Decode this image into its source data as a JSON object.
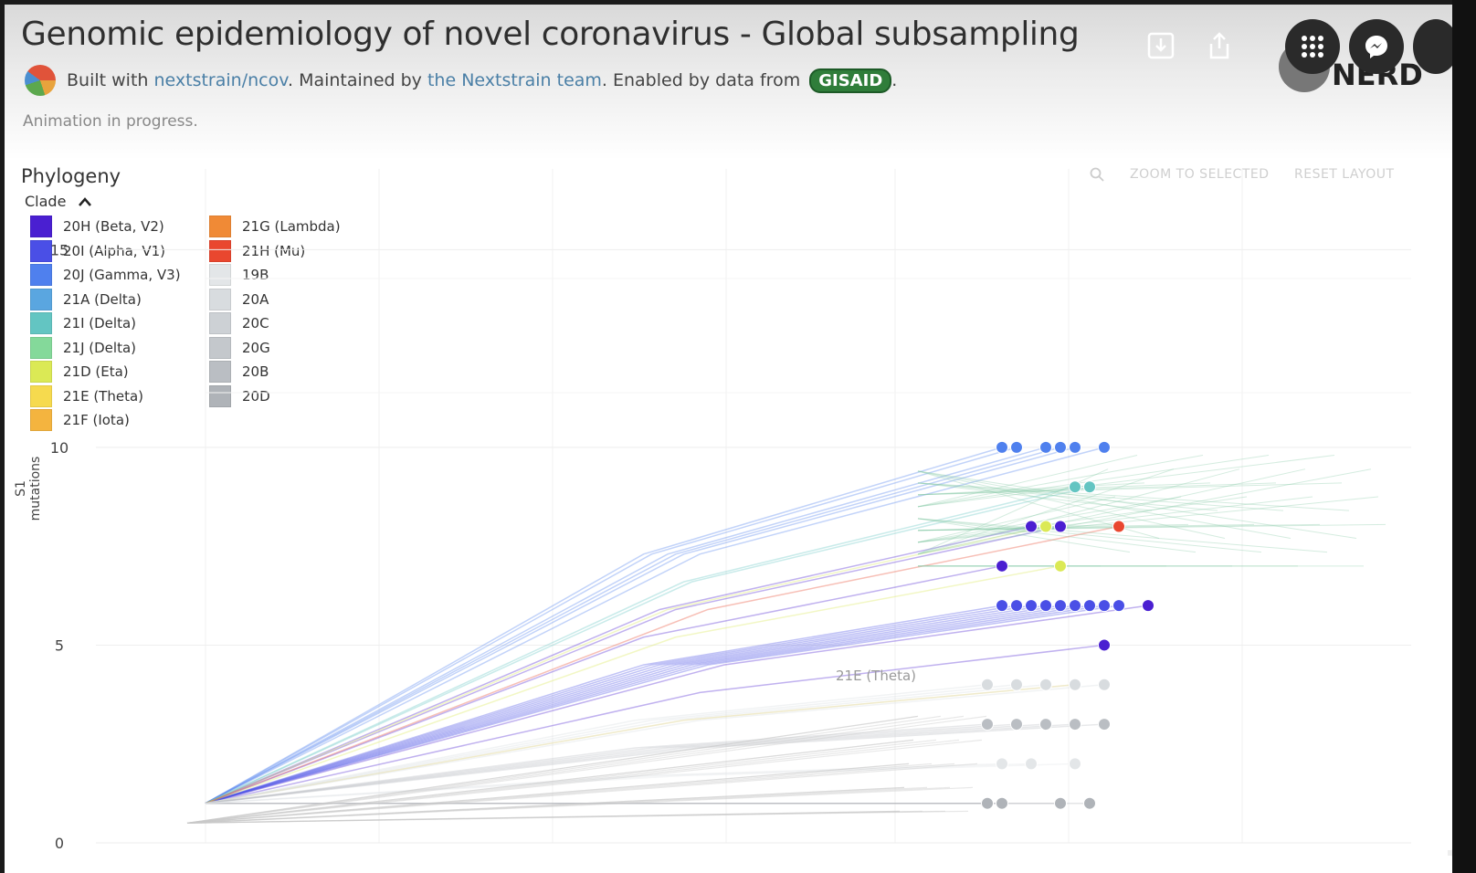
{
  "header": {
    "title": "Genomic epidemiology of novel coronavirus - Global subsampling",
    "built_prefix": "Built with ",
    "built_link": "nextstrain/ncov",
    "maintained_prefix": ". Maintained by ",
    "maintained_link": "the Nextstrain team",
    "enabled_prefix": ". Enabled by data from ",
    "gisaid": "GISAID",
    "enabled_suffix": ".",
    "status": "Animation in progress."
  },
  "icons": {
    "save": "save-icon",
    "share": "share-icon",
    "apps": "apps-grid-icon",
    "messenger": "messenger-icon",
    "mute": "mute-icon"
  },
  "brand": {
    "text": "NERD"
  },
  "panel": {
    "title": "Phylogeny",
    "legend_title": "Clade",
    "zoom_to_selected": "ZOOM TO SELECTED",
    "reset_layout": "RESET LAYOUT"
  },
  "legend": {
    "col1": [
      {
        "label": "20H (Beta, V2)",
        "color": "#4a1fd1"
      },
      {
        "label": "20I (Alpha, V1)",
        "color": "#4a4fe6"
      },
      {
        "label": "20J (Gamma, V3)",
        "color": "#4f80ee"
      },
      {
        "label": "21A (Delta)",
        "color": "#5aa6e0"
      },
      {
        "label": "21I (Delta)",
        "color": "#63c5c2"
      },
      {
        "label": "21J (Delta)",
        "color": "#84d99a"
      },
      {
        "label": "21D (Eta)",
        "color": "#dbe955"
      },
      {
        "label": "21E (Theta)",
        "color": "#f6da4e"
      },
      {
        "label": "21F (Iota)",
        "color": "#f4b43f"
      }
    ],
    "col2": [
      {
        "label": "21G (Lambda)",
        "color": "#f08a36"
      },
      {
        "label": "21H (Mu)",
        "color": "#e9472f"
      },
      {
        "label": "19B",
        "color": "#e3e6e8"
      },
      {
        "label": "20A",
        "color": "#d8dcdf"
      },
      {
        "label": "20C",
        "color": "#cdd1d5"
      },
      {
        "label": "20G",
        "color": "#c4c8cc"
      },
      {
        "label": "20B",
        "color": "#babec3"
      },
      {
        "label": "20D",
        "color": "#afb3b8"
      }
    ]
  },
  "chart_data": {
    "type": "scatter",
    "title": "Phylogeny",
    "xlabel": "",
    "ylabel": "S1 mutations",
    "ylim": [
      0,
      16
    ],
    "yticks": [
      0,
      5,
      10,
      15
    ],
    "grid": true,
    "annotation": "21E (Theta)",
    "series": [
      {
        "name": "20H (Beta, V2)",
        "x": [
          0.62,
          0.64,
          0.66,
          0.69,
          0.72
        ],
        "y": [
          7,
          8,
          8,
          5,
          6
        ]
      },
      {
        "name": "20I (Alpha, V1)",
        "x": [
          0.62,
          0.63,
          0.64,
          0.65,
          0.66,
          0.67,
          0.68,
          0.69,
          0.7
        ],
        "y": [
          6,
          6,
          6,
          6,
          6,
          6,
          6,
          6,
          6
        ]
      },
      {
        "name": "20J (Gamma, V3)",
        "x": [
          0.62,
          0.63,
          0.65,
          0.66,
          0.67,
          0.69
        ],
        "y": [
          10,
          10,
          10,
          10,
          10,
          10
        ]
      },
      {
        "name": "21I (Delta)",
        "x": [
          0.67,
          0.68
        ],
        "y": [
          9,
          9
        ]
      },
      {
        "name": "21D (Eta)",
        "x": [
          0.65,
          0.66
        ],
        "y": [
          8,
          7
        ]
      },
      {
        "name": "21E (Theta)",
        "x": [
          0.67
        ],
        "y": [
          4
        ]
      },
      {
        "name": "21H (Mu)",
        "x": [
          0.7
        ],
        "y": [
          8
        ]
      },
      {
        "name": "20A",
        "x": [
          0.61,
          0.63,
          0.65,
          0.67,
          0.69
        ],
        "y": [
          4,
          4,
          4,
          4,
          4
        ]
      },
      {
        "name": "20B",
        "x": [
          0.61,
          0.63,
          0.65,
          0.67,
          0.69
        ],
        "y": [
          3,
          3,
          3,
          3,
          3
        ]
      },
      {
        "name": "20D",
        "x": [
          0.61,
          0.62,
          0.66,
          0.68
        ],
        "y": [
          1,
          1,
          1,
          1
        ]
      },
      {
        "name": "19B",
        "x": [
          0.62,
          0.64,
          0.67
        ],
        "y": [
          2,
          2,
          2
        ]
      }
    ]
  }
}
